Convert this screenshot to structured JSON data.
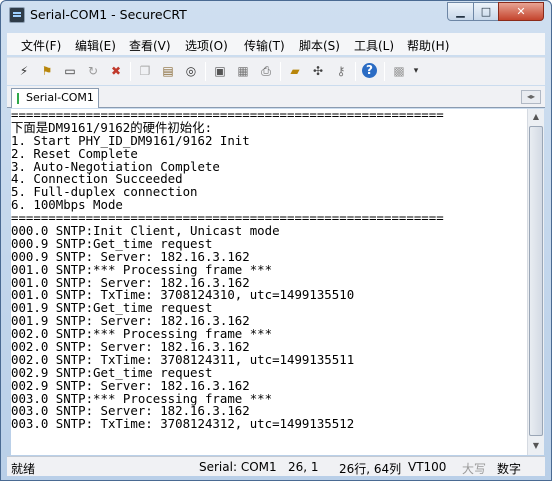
{
  "window": {
    "title": "Serial-COM1 - SecureCRT"
  },
  "title_buttons": {
    "minimize": "▁",
    "maximize": "□",
    "close": "✕"
  },
  "menu": [
    "文件(F)",
    "编辑(E)",
    "查看(V)",
    "选项(O)",
    "传输(T)",
    "脚本(S)",
    "工具(L)",
    "帮助(H)"
  ],
  "toolbar_icons": [
    "connect-icon",
    "quick-connect-icon",
    "connect-in-tab-icon",
    "reconnect-icon",
    "disconnect-icon",
    "copy-icon",
    "paste-icon",
    "find-icon",
    "print-screen-icon",
    "print-setup-icon",
    "print-icon",
    "session-options-icon",
    "keymap-icon",
    "key-agent-icon",
    "help-icon",
    "keypad-icon",
    "toolbar-more-icon"
  ],
  "tab": {
    "label": "Serial-COM1"
  },
  "terminal_lines": [
    "==========================================================",
    "下面是DM9161/9162的硬件初始化:",
    "1. Start PHY_ID_DM9161/9162 Init",
    "2. Reset Complete",
    "3. Auto-Negotiation Complete",
    "4. Connection Succeeded",
    "5. Full-duplex connection",
    "6. 100Mbps Mode",
    "==========================================================",
    "000.0 SNTP:Init Client, Unicast mode",
    "000.9 SNTP:Get_time request",
    "000.9 SNTP: Server: 182.16.3.162",
    "001.0 SNTP:*** Processing frame ***",
    "001.0 SNTP: Server: 182.16.3.162",
    "001.0 SNTP: TxTime: 3708124310, utc=1499135510",
    "001.9 SNTP:Get_time request",
    "001.9 SNTP: Server: 182.16.3.162",
    "002.0 SNTP:*** Processing frame ***",
    "002.0 SNTP: Server: 182.16.3.162",
    "002.0 SNTP: TxTime: 3708124311, utc=1499135511",
    "002.9 SNTP:Get_time request",
    "002.9 SNTP: Server: 182.16.3.162",
    "003.0 SNTP:*** Processing frame ***",
    "003.0 SNTP: Server: 182.16.3.162",
    "003.0 SNTP: TxTime: 3708124312, utc=1499135512"
  ],
  "status": {
    "ready": "就绪",
    "connection": "Serial: COM1",
    "position": "26,  1",
    "rows_cols": "26行, 64列",
    "emulation": "VT100",
    "caps": "大写",
    "num": "数字"
  }
}
